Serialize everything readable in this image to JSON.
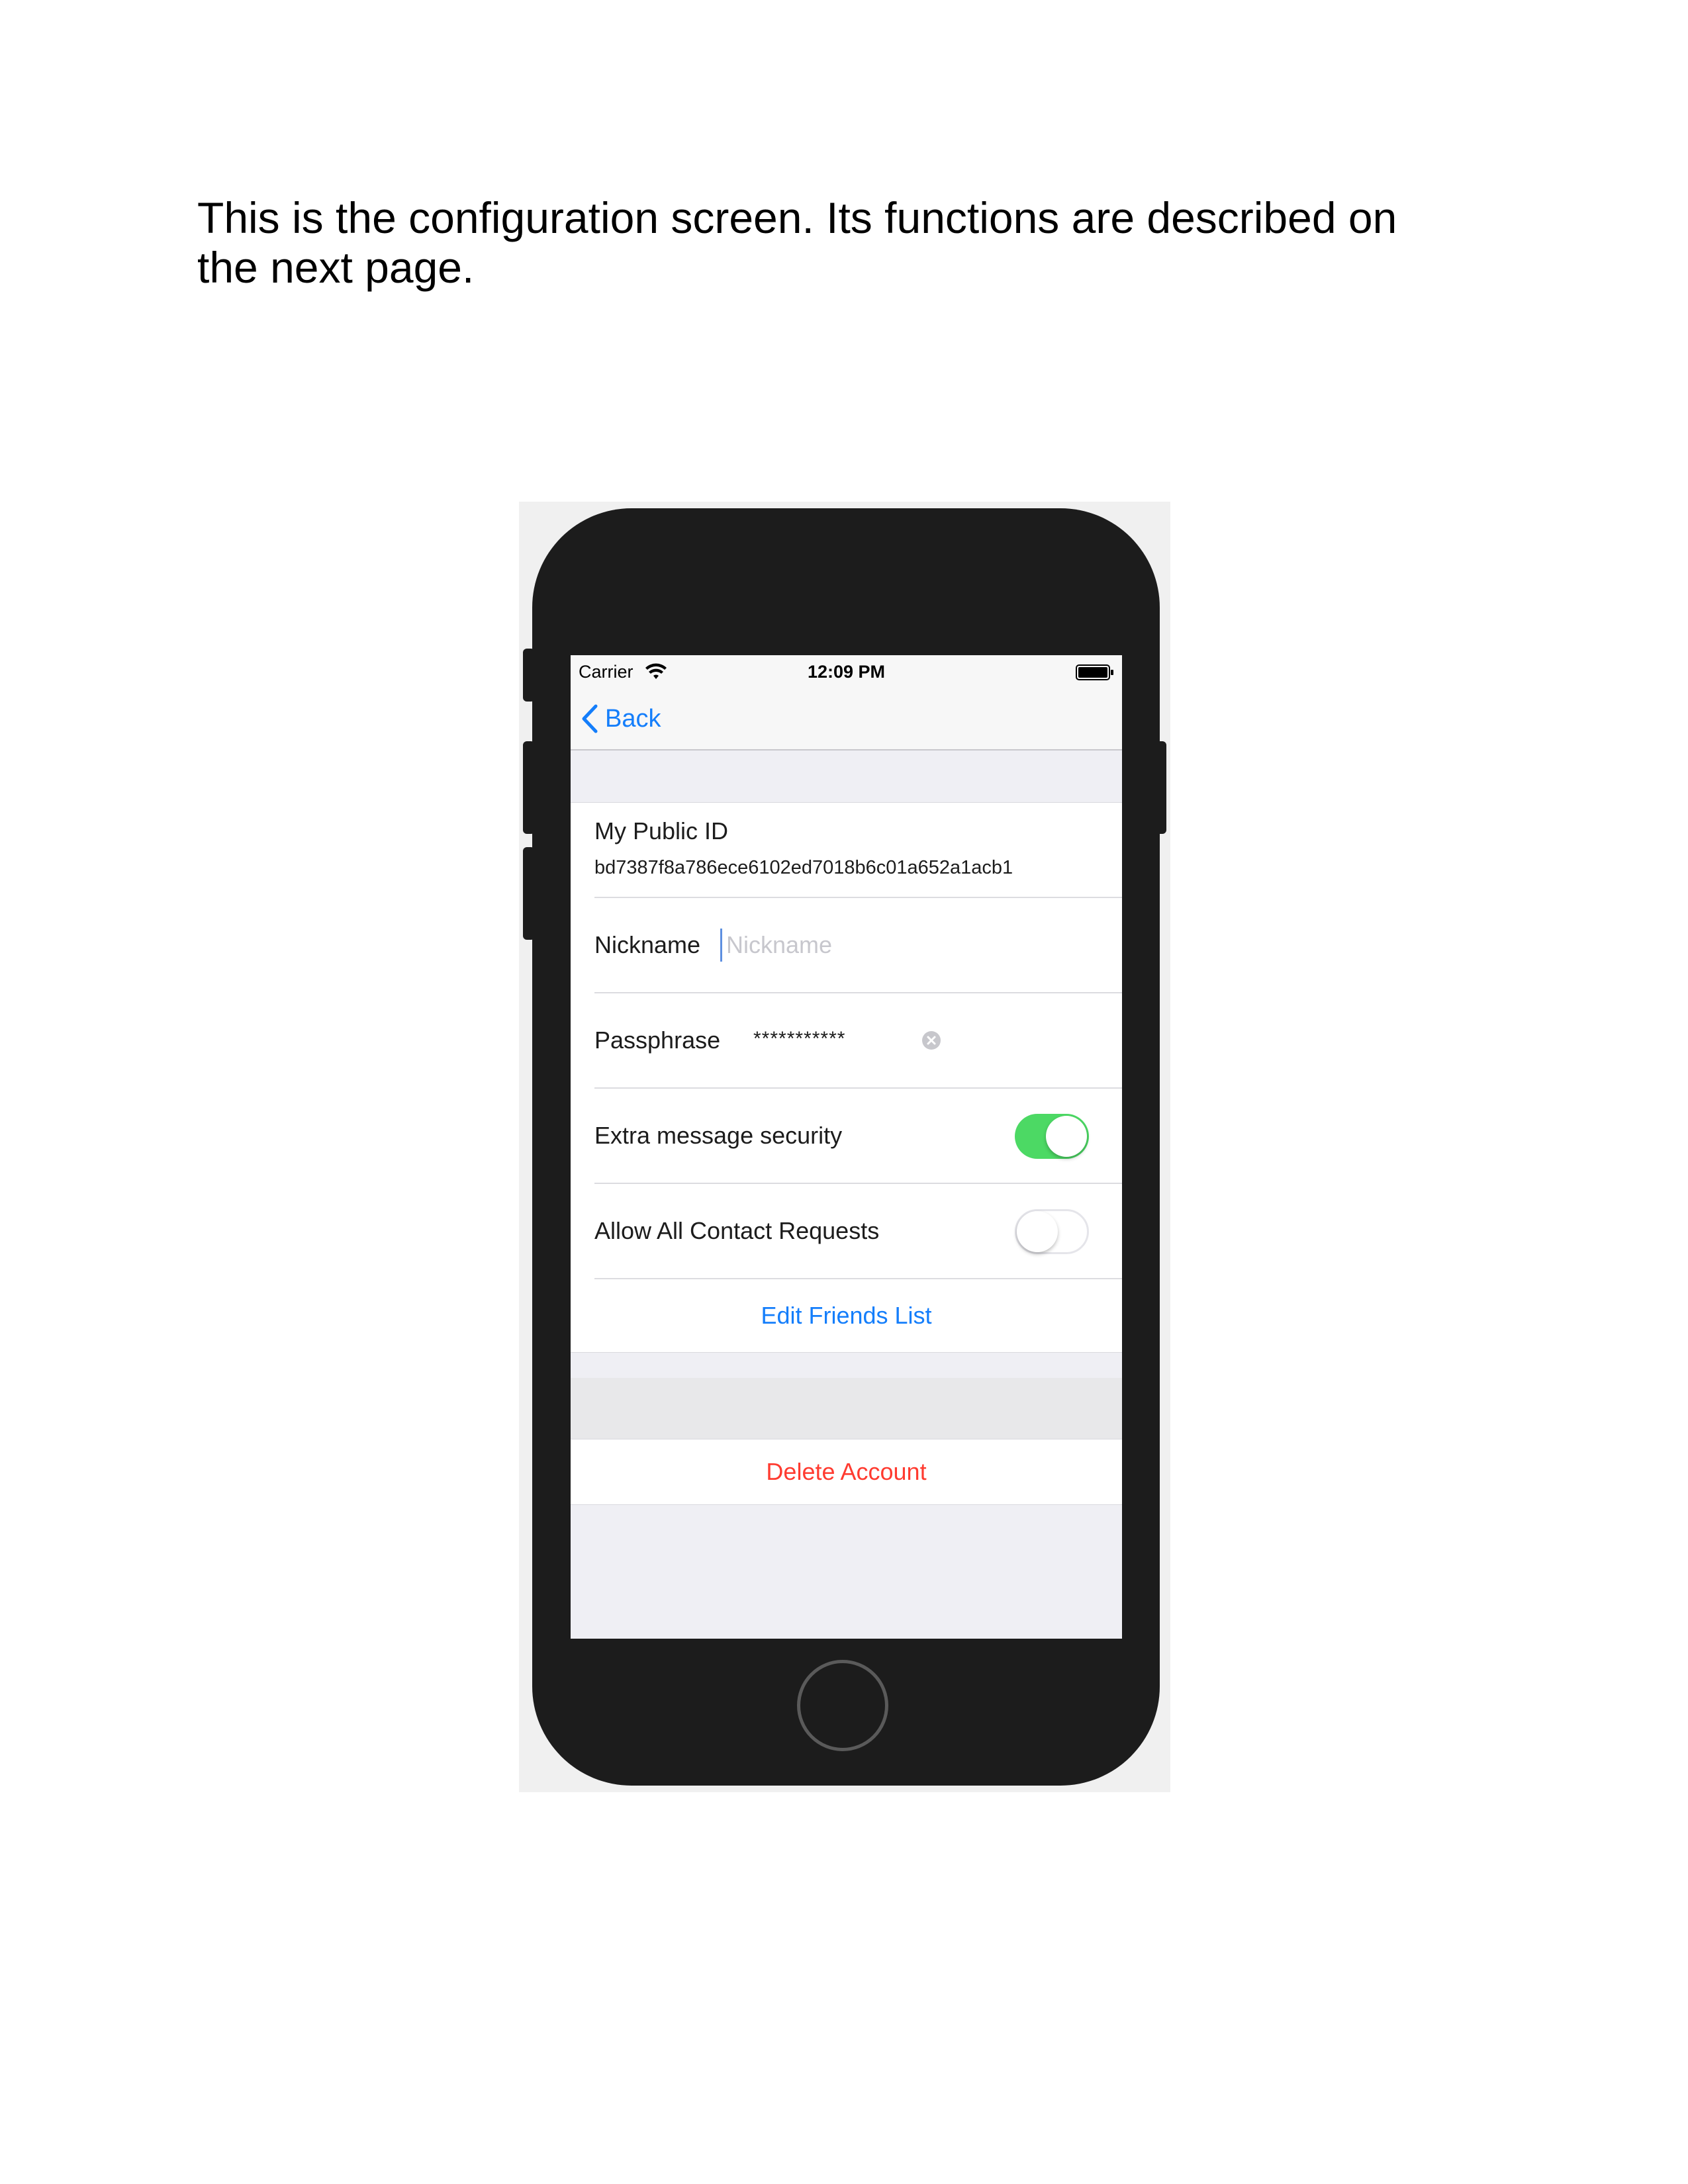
{
  "caption": {
    "line1": "This is the configuration screen. Its functions are described on",
    "line2": "the next page."
  },
  "status_bar": {
    "carrier": "Carrier",
    "time": "12:09 PM",
    "wifi_icon": "wifi-icon",
    "battery_icon": "battery-icon"
  },
  "nav": {
    "back_label": "Back",
    "back_icon": "chevron-left-icon",
    "tint_color": "#147efb"
  },
  "settings": {
    "public_id_label": "My Public ID",
    "public_id_value": "bd7387f8a786ece6102ed7018b6c01a652a1acb1",
    "nickname_label": "Nickname",
    "nickname_value": "",
    "nickname_placeholder": "Nickname",
    "passphrase_label": "Passphrase",
    "passphrase_value": "***********",
    "passphrase_clear_icon": "clear-icon",
    "extra_security_label": "Extra message security",
    "extra_security_on": true,
    "allow_requests_label": "Allow All Contact Requests",
    "allow_requests_on": false,
    "edit_friends_label": "Edit Friends List",
    "delete_account_label": "Delete Account",
    "toggle_on_color": "#4cd964",
    "destructive_color": "#ff3b30"
  }
}
